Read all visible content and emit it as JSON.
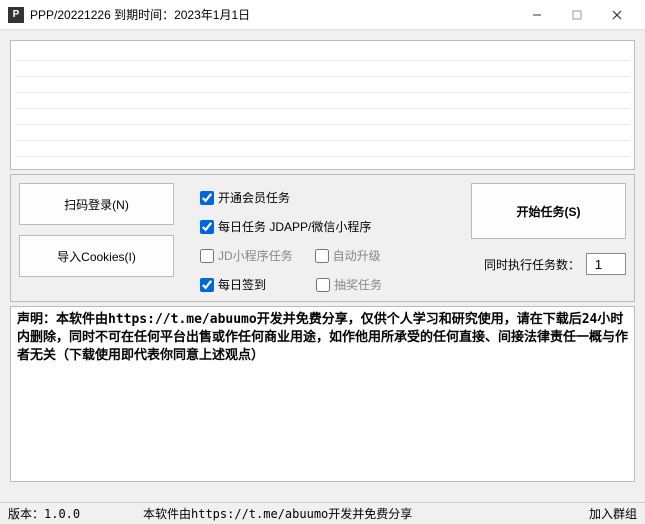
{
  "window": {
    "icon_text": "P",
    "title": "PPP/20221226  到期时间：2023年1月1日"
  },
  "buttons": {
    "scan_login": "扫码登录(N)",
    "import_cookies": "导入Cookies(I)",
    "start_task": "开始任务(S)"
  },
  "checkboxes": {
    "vip_task": "开通会员任务",
    "daily_task": "每日任务 JDAPP/微信小程序",
    "jd_mini": "JD小程序任务",
    "auto_upgrade": "自动升级",
    "daily_signin": "每日签到",
    "lottery": "抽奖任务"
  },
  "concurrent": {
    "label": "同时执行任务数：",
    "value": "1"
  },
  "disclaimer": "声明：本软件由https://t.me/abuumo开发并免费分享，仅供个人学习和研究使用，请在下载后24小时内删除，同时不可在任何平台出售或作任何商业用途，如作他用所承受的任何直接、间接法律责任一概与作者无关（下载使用即代表你同意上述观点）",
  "statusbar": {
    "version": "版本：1.0.0",
    "credit": "本软件由https://t.me/abuumo开发并免费分享",
    "join_group": "加入群组"
  }
}
